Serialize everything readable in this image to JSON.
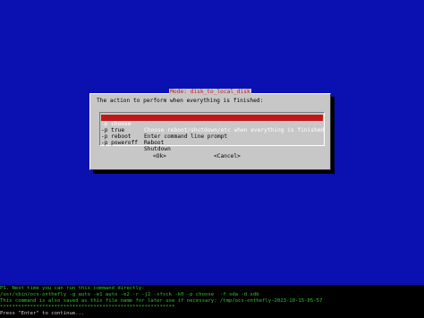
{
  "dialog": {
    "title": "Mode: disk_to_local_disk",
    "prompt": "The action to perform when everything is finished:",
    "items": [
      {
        "tag": "-p choose",
        "desc": "Choose reboot/shutdown/etc when everything is finished",
        "selected": true
      },
      {
        "tag": "-p true",
        "desc": "Enter command line prompt",
        "selected": false
      },
      {
        "tag": "-p reboot",
        "desc": "Reboot",
        "selected": false
      },
      {
        "tag": "-p poweroff",
        "desc": "Shutdown",
        "selected": false
      }
    ],
    "ok_label": "<Ok>",
    "cancel_label": "<Cancel>"
  },
  "terminal": {
    "lines": [
      {
        "text": "PS. Next time you can run this command directly:",
        "color": "green"
      },
      {
        "text": "/usr/sbin/ocs-onthefly -g auto -e1 auto -e2 -r -j2 -sfsck -k0 -p choose  -f sda -d sdb",
        "color": "green"
      },
      {
        "text": "This command is also saved as this file name for later use if necessary: /tmp/ocs-onthefly-2023-10-15-05-57",
        "color": "green"
      },
      {
        "text": "**********************************************************",
        "color": "green"
      },
      {
        "text": "Press \"Enter\" to continue...",
        "color": "white"
      }
    ]
  },
  "colors": {
    "background": "#0a11b0",
    "dialog": "#c7c7c7",
    "highlight": "#c01818",
    "terminal_text": "#2fc42f"
  }
}
